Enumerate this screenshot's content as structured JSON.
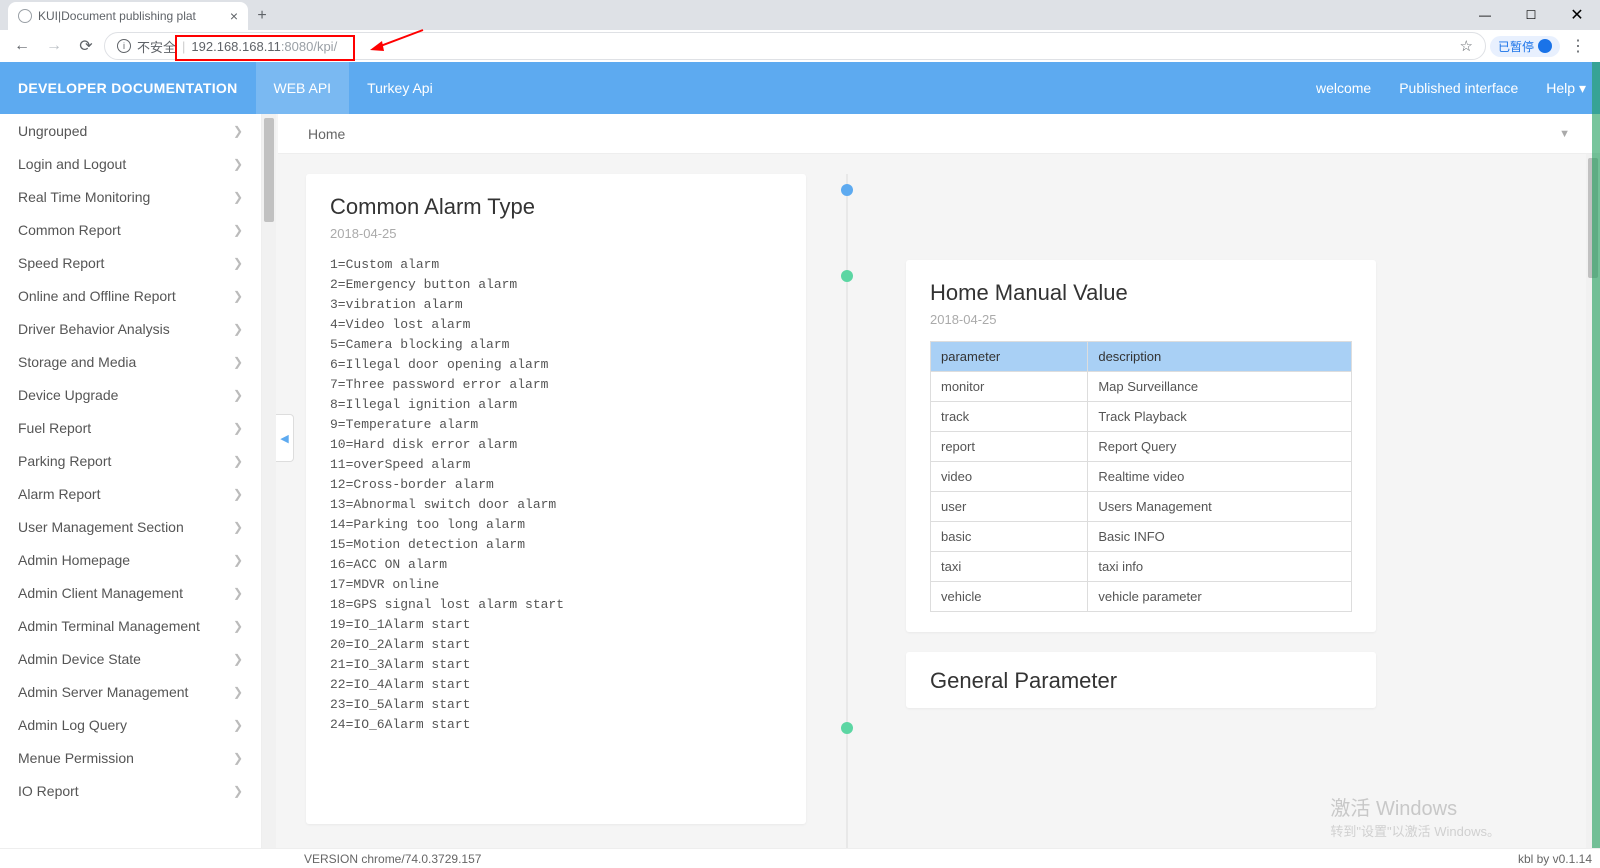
{
  "browser": {
    "tab_title": "KUI|Document publishing plat",
    "insecure_label": "不安全",
    "url_host": "192.168.168.11",
    "url_port": ":8080/kpi/",
    "pause_label": "已暂停"
  },
  "nav": {
    "brand": "DEVELOPER DOCUMENTATION",
    "items": [
      "WEB API",
      "Turkey Api"
    ],
    "right": [
      "welcome",
      "Published interface",
      "Help"
    ]
  },
  "sidebar": {
    "items": [
      "Ungrouped",
      "Login and Logout",
      "Real Time Monitoring",
      "Common Report",
      "Speed Report",
      "Online and Offline Report",
      "Driver Behavior Analysis",
      "Storage and Media",
      "Device Upgrade",
      "Fuel Report",
      "Parking Report",
      "Alarm Report",
      "User Management Section",
      "Admin Homepage",
      "Admin Client Management",
      "Admin Terminal Management",
      "Admin Device State",
      "Admin Server Management",
      "Admin Log Query",
      "Menue Permission",
      "IO Report"
    ]
  },
  "breadcrumb": "Home",
  "card1": {
    "title": "Common Alarm Type",
    "date": "2018-04-25",
    "lines": [
      "1=Custom alarm",
      "2=Emergency button alarm",
      "3=vibration alarm",
      "4=Video lost alarm",
      "5=Camera blocking alarm",
      "6=Illegal door opening alarm",
      "7=Three password error alarm",
      "8=Illegal ignition alarm",
      "9=Temperature alarm",
      "10=Hard disk error alarm",
      "11=overSpeed alarm",
      "12=Cross-border alarm",
      "13=Abnormal switch door alarm",
      "14=Parking too long alarm",
      "15=Motion detection alarm",
      "16=ACC ON alarm",
      "17=MDVR online",
      "18=GPS signal lost alarm start",
      "19=IO_1Alarm start",
      "20=IO_2Alarm start",
      "21=IO_3Alarm start",
      "22=IO_4Alarm start",
      "23=IO_5Alarm start",
      "24=IO_6Alarm start"
    ]
  },
  "card2": {
    "title": "Home Manual Value",
    "date": "2018-04-25",
    "headers": [
      "parameter",
      "description"
    ],
    "rows": [
      [
        "monitor",
        "Map Surveillance"
      ],
      [
        "track",
        "Track Playback"
      ],
      [
        "report",
        "Report Query"
      ],
      [
        "video",
        "Realtime video"
      ],
      [
        "user",
        "Users Management"
      ],
      [
        "basic",
        "Basic INFO"
      ],
      [
        "taxi",
        "taxi info"
      ],
      [
        "vehicle",
        "vehicle parameter"
      ]
    ]
  },
  "card3": {
    "title": "General Parameter"
  },
  "footer": {
    "version": "VERSION chrome/74.0.3729.157",
    "right": "kbl by v0.1.14"
  },
  "watermark": {
    "title": "激活 Windows",
    "sub": "转到\"设置\"以激活 Windows。"
  }
}
